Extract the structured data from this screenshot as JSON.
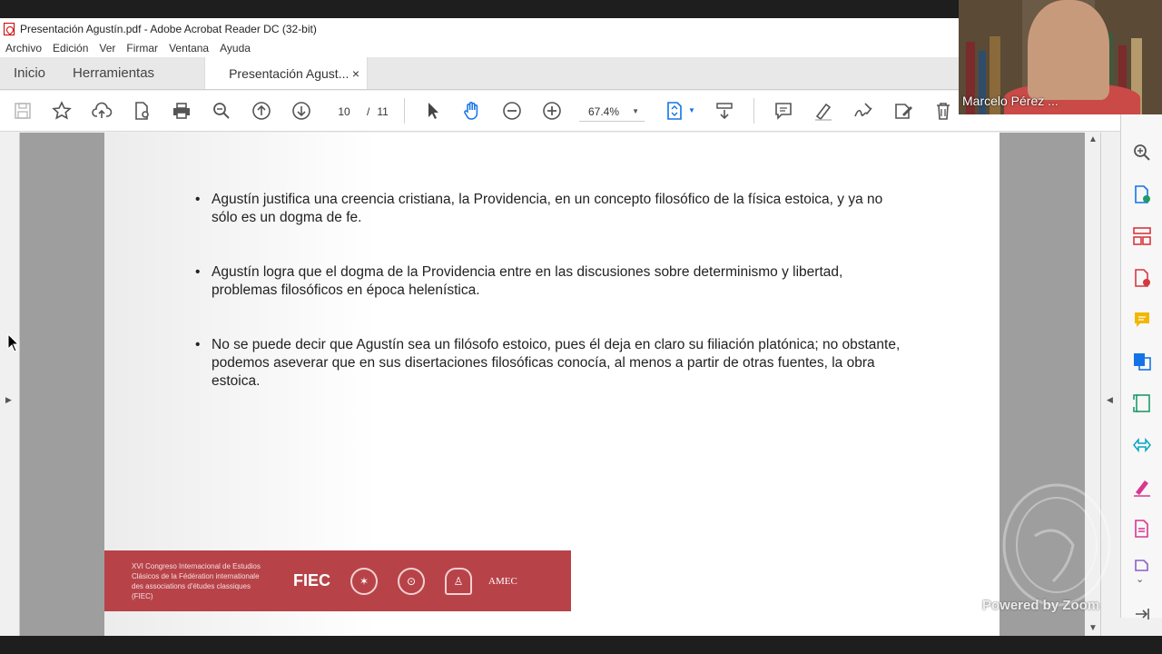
{
  "window": {
    "title": "Presentación Agustín.pdf - Adobe Acrobat Reader DC (32-bit)"
  },
  "menu": [
    "Archivo",
    "Edición",
    "Ver",
    "Firmar",
    "Ventana",
    "Ayuda"
  ],
  "tabs": {
    "home": "Inicio",
    "tools": "Herramientas",
    "document": "Presentación Agust...",
    "close": "×"
  },
  "toolbar": {
    "current_page": "10",
    "separator": "/",
    "total_pages": "11",
    "zoom": "67.4%"
  },
  "slide": {
    "bullets": [
      "Agustín justifica una creencia cristiana, la Providencia, en un concepto filosófico de la física estoica, y ya no sólo es un dogma de fe.",
      "Agustín logra que el dogma de la Providencia entre en las discusiones sobre determinismo y libertad, problemas filosóficos en época helenística.",
      "No se puede decir que Agustín sea un filósofo estoico, pues él deja en claro su filiación platónica; no obstante, podemos aseverar que en sus disertaciones filosóficas conocía, al menos a partir de otras fuentes, la obra estoica."
    ],
    "banner_text": "XVI Congreso Internacional de Estudios Clásicos de la Fédération internationale des associations d'études classiques (FIEC)",
    "logos": [
      "FIEC",
      "AMEC"
    ]
  },
  "zoom": {
    "participant_name": "Marcelo Pérez ...",
    "watermark": "Powered by Zoom"
  },
  "colors": {
    "banner": "#b74349",
    "accent_blue": "#1473e6",
    "acrobat_red": "#c00000"
  }
}
